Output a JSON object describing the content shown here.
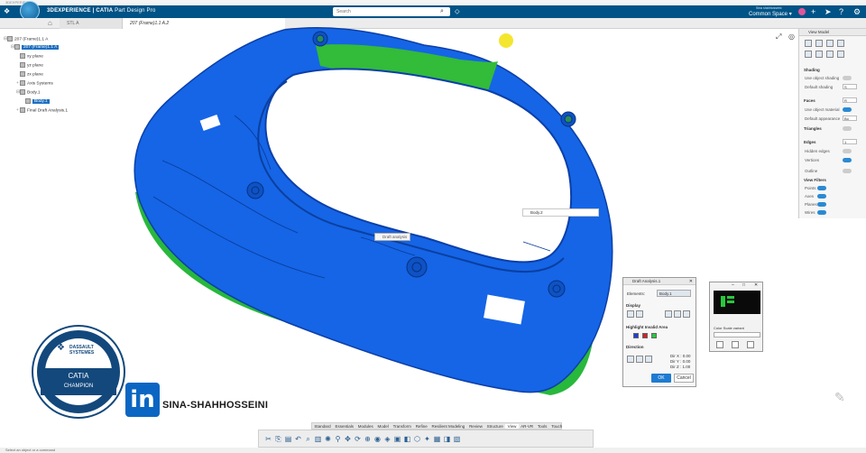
{
  "window": {
    "title": "3DEXPERIENCE"
  },
  "topbar": {
    "brand": "3DEXPERIENCE | CATIA",
    "app": "Part Design Pro",
    "search_placeholder": "Search",
    "user": "Sina shahhosseini",
    "space": "Common Space"
  },
  "tabs": [
    {
      "label": "STL A"
    },
    {
      "label": "207 (Frame)1.1 A.2"
    }
  ],
  "tree": {
    "nodes": [
      {
        "label": "207 (Frame)1.1 A"
      },
      {
        "label": "207 (Frame)1.1 A"
      },
      {
        "label": "xy plane"
      },
      {
        "label": "yz plane"
      },
      {
        "label": "zx plane"
      },
      {
        "label": "Axis Systems"
      },
      {
        "label": "Body.1"
      },
      {
        "label": "Body.1"
      },
      {
        "label": "Final Draft Analysis.1"
      }
    ]
  },
  "viewport": {
    "labels": {
      "body_tag": "Body.2",
      "center_tag": "Draft analysis"
    },
    "colors": {
      "body": "#1565e6",
      "valid": "#28b83c",
      "cursor": "#f2e20a"
    }
  },
  "view_model": {
    "title": "View Model",
    "sections": {
      "shading": "Shading",
      "faces": "Faces",
      "triangles": "Triangles",
      "edges": "Edges",
      "view_filters": "View Filters"
    },
    "rows": {
      "use_object_shading": "Use object shading",
      "default_shading": "Default shading",
      "use_object_material": "Use object material",
      "default_appearance": "Default appearance",
      "hidden_edges": "Hidden edges",
      "vertices": "Vertices",
      "outline": "Outline",
      "points": "Points",
      "axes": "Axes",
      "planes": "Planes",
      "wires": "Wires"
    },
    "values": {
      "shading_dd": "S",
      "faces_dd": "R",
      "appearance_dd": "Bo",
      "edges_dd": "1"
    }
  },
  "draft_dialog": {
    "title": "Draft Analysis.1",
    "elements_label": "Elements:",
    "elements_value": "Body.1",
    "display": "Display",
    "highlight": "Highlight Invalid Area",
    "direction": "Direction",
    "dir_x": "Dir X : 0.00",
    "dir_y": "Dir Y : 0.00",
    "dir_z": "Dir Z : 1.00",
    "ok": "OK",
    "cancel": "Cancel",
    "colors": [
      "#1f3fd6",
      "#d81e1e",
      "#28c83c"
    ]
  },
  "color_scale": {
    "title": "",
    "subtitle": "Color Scale variant"
  },
  "watermark": {
    "brand_top": "DASSAULT",
    "brand_bottom": "SYSTEMES",
    "product": "CATIA",
    "role": "CHAMPION",
    "linkedin": "in",
    "handle": "SINA-SHAHHOSSEINI"
  },
  "action_tabs": [
    "Standard",
    "Essentials",
    "Modules",
    "Model",
    "Transform",
    "Refine",
    "Resilient Modeling",
    "Review",
    "Structure",
    "View",
    "AR-VR",
    "Tools",
    "Touch"
  ],
  "active_action_tab": "View",
  "status": {
    "text": "Select an object or a command"
  }
}
